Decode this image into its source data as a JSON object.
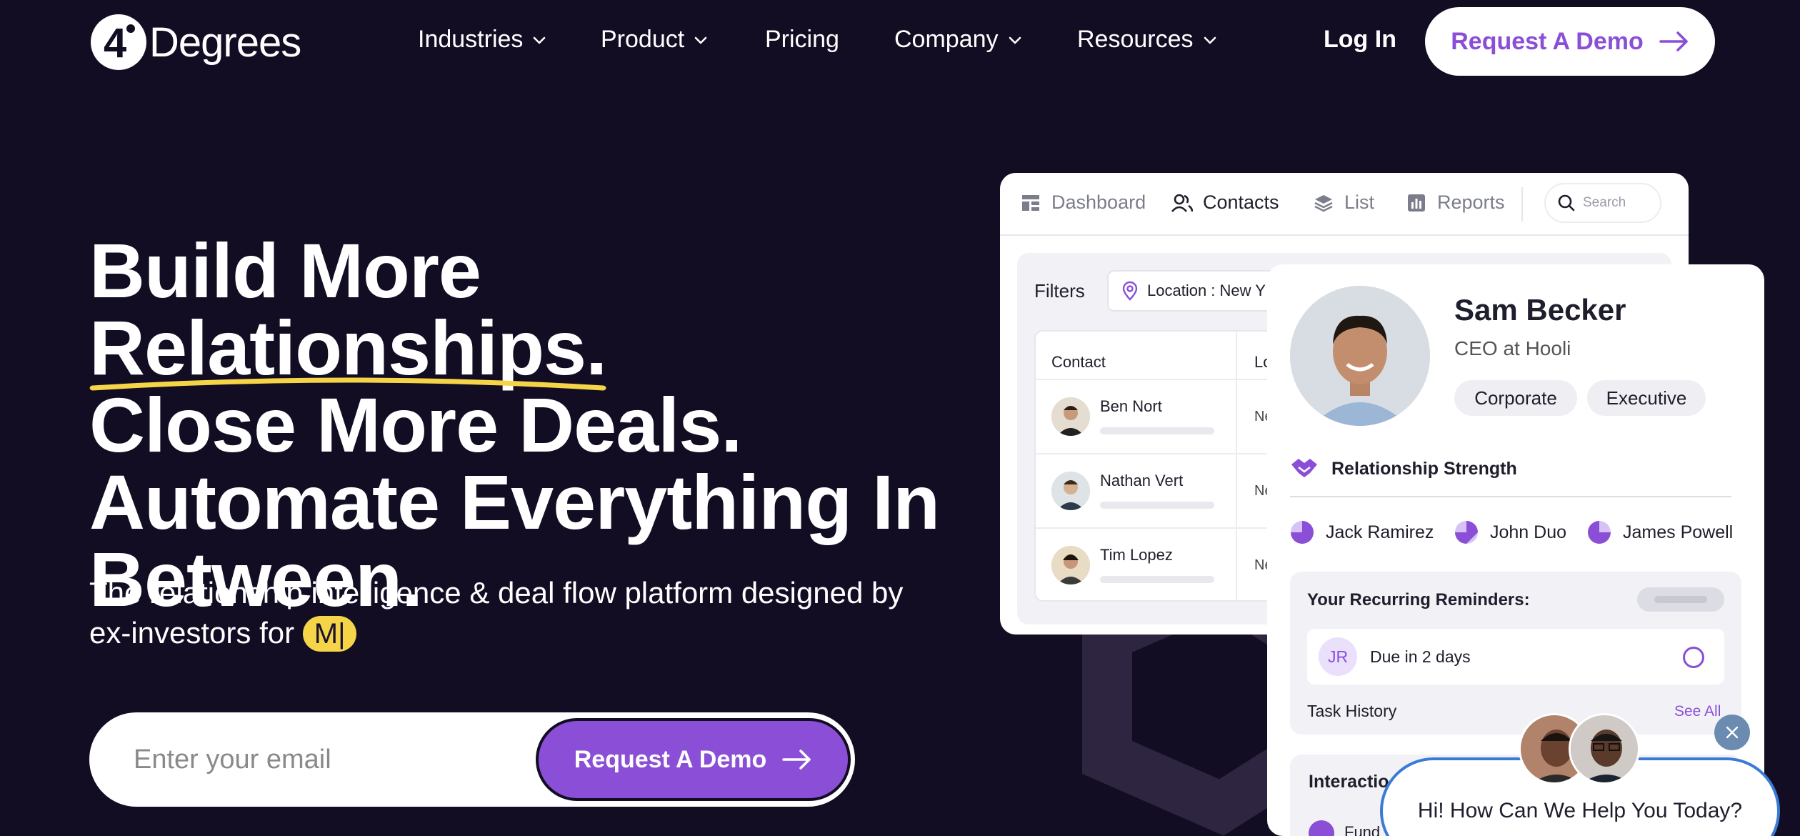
{
  "nav": {
    "logo_text": "Degrees",
    "logo_mark": "4",
    "items": [
      {
        "label": "Industries",
        "has_dropdown": true
      },
      {
        "label": "Product",
        "has_dropdown": true
      },
      {
        "label": "Pricing",
        "has_dropdown": false
      },
      {
        "label": "Company",
        "has_dropdown": true
      },
      {
        "label": "Resources",
        "has_dropdown": true
      }
    ],
    "login_label": "Log In",
    "cta_label": "Request A Demo"
  },
  "hero": {
    "line1_a": "Build More ",
    "line1_b": "Relationships.",
    "line2": "Close More Deals.",
    "line3": "Automate Everything In",
    "line4": "Between.",
    "subtitle": "The relationship intelligence & deal flow platform designed by ex-investors for ",
    "typed_text": "M|",
    "email_placeholder": "Enter your email",
    "form_cta_label": "Request A Demo"
  },
  "mock_app": {
    "tabs": [
      {
        "label": "Dashboard",
        "icon": "grid-icon"
      },
      {
        "label": "Contacts",
        "icon": "users-icon",
        "active": true
      },
      {
        "label": "List",
        "icon": "layers-icon"
      },
      {
        "label": "Reports",
        "icon": "bar-chart-icon"
      }
    ],
    "search_placeholder": "Search",
    "filters_label": "Filters",
    "location_filter": "Location : New Y",
    "table_headers": [
      "Contact",
      "Lo"
    ],
    "rows": [
      {
        "name": "Ben Nort",
        "loc": "Ne"
      },
      {
        "name": "Nathan Vert",
        "loc": "Ne"
      },
      {
        "name": "Tim Lopez",
        "loc": "Ne"
      }
    ]
  },
  "profile": {
    "name": "Sam Becker",
    "title": "CEO at Hooli",
    "tags": [
      "Corporate",
      "Executive"
    ],
    "relationship_label": "Relationship Strength",
    "people": [
      "Jack Ramirez",
      "John Duo",
      "James Powell"
    ],
    "reminders_title": "Your Recurring Reminders:",
    "reminder_initials": "JR",
    "reminder_due": "Due in 2 days",
    "task_history": "Task History",
    "see_all": "See All",
    "interactions_title": "Interactio",
    "interaction_item": "Fund"
  },
  "chat": {
    "message": "Hi! How Can We Help You Today?"
  },
  "colors": {
    "background": "#130d24",
    "accent": "#8a4fd6",
    "highlight": "#f5d547",
    "chat_border": "#3a7bd5"
  }
}
